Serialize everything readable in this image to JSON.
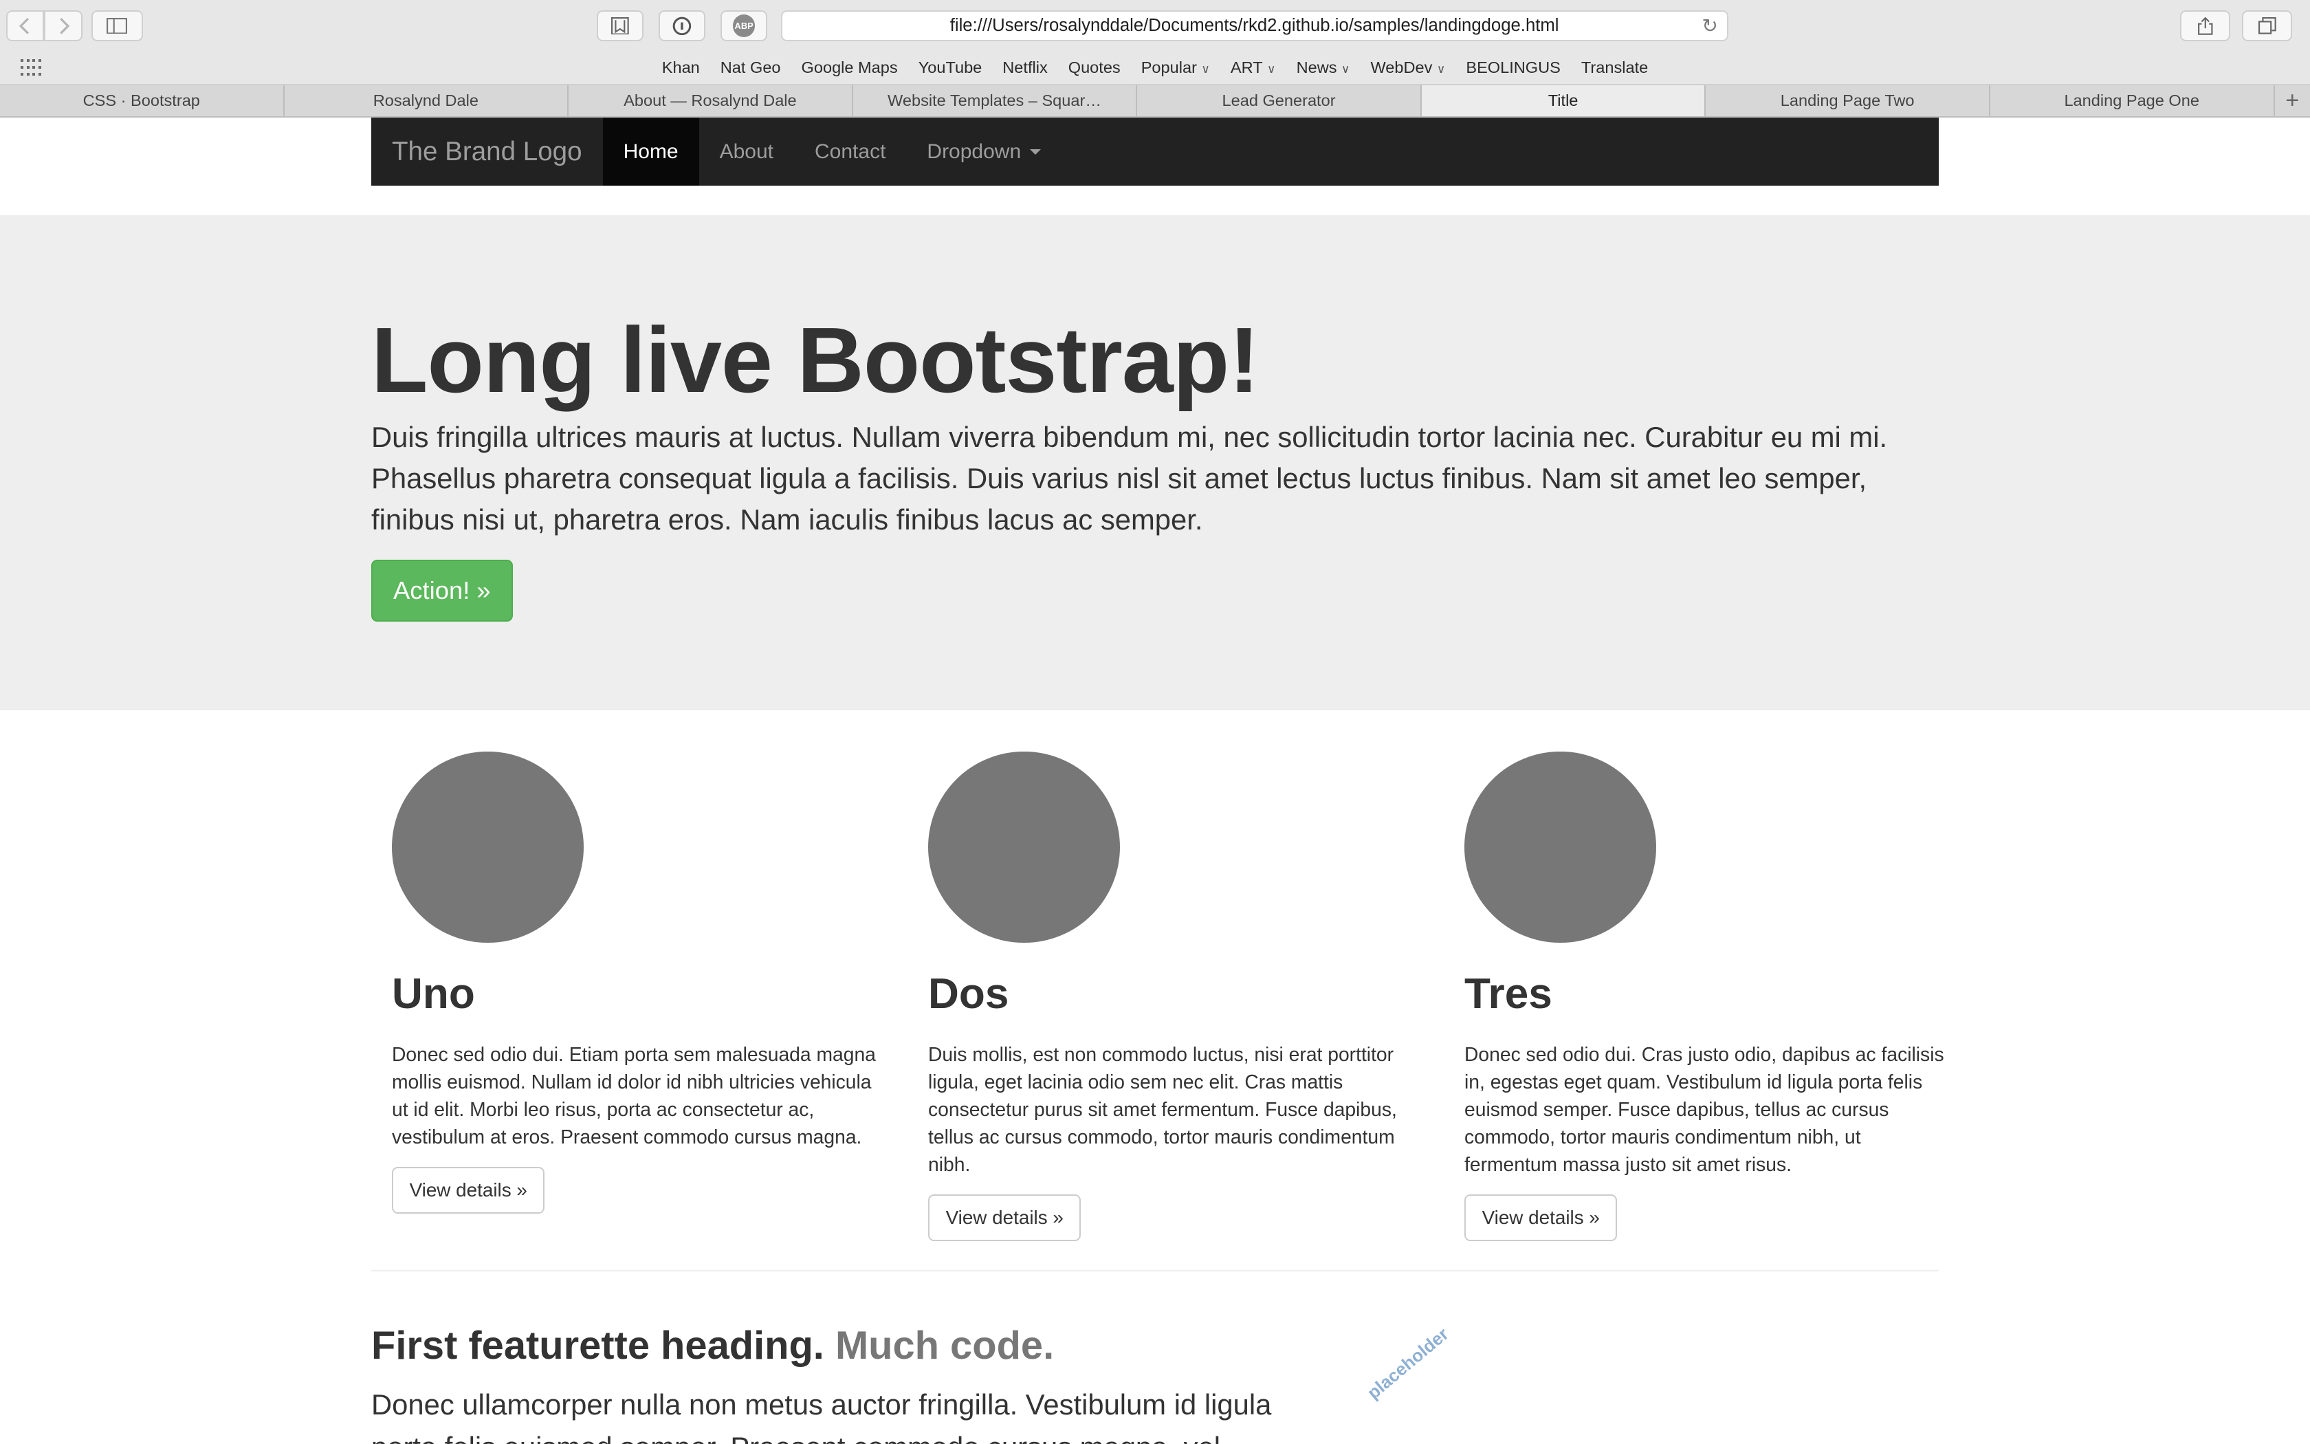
{
  "browser": {
    "url": "file:///Users/rosalynddale/Documents/rkd2.github.io/samples/landingdoge.html",
    "favorites": [
      {
        "label": "Khan",
        "dropdown": false
      },
      {
        "label": "Nat Geo",
        "dropdown": false
      },
      {
        "label": "Google Maps",
        "dropdown": false
      },
      {
        "label": "YouTube",
        "dropdown": false
      },
      {
        "label": "Netflix",
        "dropdown": false
      },
      {
        "label": "Quotes",
        "dropdown": false
      },
      {
        "label": "Popular",
        "dropdown": true
      },
      {
        "label": "ART",
        "dropdown": true
      },
      {
        "label": "News",
        "dropdown": true
      },
      {
        "label": "WebDev",
        "dropdown": true
      },
      {
        "label": "BEOLINGUS",
        "dropdown": false
      },
      {
        "label": "Translate",
        "dropdown": false
      }
    ],
    "tabs": [
      {
        "label": "CSS · Bootstrap",
        "active": false
      },
      {
        "label": "Rosalynd Dale",
        "active": false
      },
      {
        "label": "About — Rosalynd Dale",
        "active": false
      },
      {
        "label": "Website Templates – Squar…",
        "active": false
      },
      {
        "label": "Lead Generator",
        "active": false
      },
      {
        "label": "Title",
        "active": true
      },
      {
        "label": "Landing Page Two",
        "active": false
      },
      {
        "label": "Landing Page One",
        "active": false
      }
    ],
    "abp_label": "ABP"
  },
  "navbar": {
    "brand": "The Brand Logo",
    "items": [
      {
        "label": "Home",
        "active": true
      },
      {
        "label": "About",
        "active": false
      },
      {
        "label": "Contact",
        "active": false
      }
    ],
    "dropdown_label": "Dropdown"
  },
  "jumbotron": {
    "title": "Long live Bootstrap!",
    "text": "Duis fringilla ultrices mauris at luctus. Nullam viverra bibendum mi, nec sollicitudin tortor lacinia nec. Curabitur eu mi mi. Phasellus pharetra consequat ligula a facilisis. Duis varius nisl sit amet lectus luctus finibus. Nam sit amet leo semper, finibus nisi ut, pharetra eros. Nam iaculis finibus lacus ac semper.",
    "button": "Action! »"
  },
  "columns": [
    {
      "heading": "Uno",
      "text": "Donec sed odio dui. Etiam porta sem malesuada magna mollis euismod. Nullam id dolor id nibh ultricies vehicula ut id elit. Morbi leo risus, porta ac consectetur ac, vestibulum at eros. Praesent commodo cursus magna.",
      "button": "View details »"
    },
    {
      "heading": "Dos",
      "text": "Duis mollis, est non commodo luctus, nisi erat porttitor ligula, eget lacinia odio sem nec elit. Cras mattis consectetur purus sit amet fermentum. Fusce dapibus, tellus ac cursus commodo, tortor mauris condimentum nibh.",
      "button": "View details »"
    },
    {
      "heading": "Tres",
      "text": "Donec sed odio dui. Cras justo odio, dapibus ac facilisis in, egestas eget quam. Vestibulum id ligula porta felis euismod semper. Fusce dapibus, tellus ac cursus commodo, tortor mauris condimentum nibh, ut fermentum massa justo sit amet risus.",
      "button": "View details »"
    }
  ],
  "featurette": {
    "heading": "First featurette heading.",
    "heading_muted": "Much code.",
    "text": "Donec ullamcorper nulla non metus auctor fringilla. Vestibulum id ligula porta felis euismod semper. Praesent commodo cursus magna, vel",
    "image_label": "placeholder"
  },
  "colors": {
    "navbar_bg": "#222222",
    "jumbotron_bg": "#eeeeee",
    "success": "#5cb85c",
    "circle": "#777777"
  }
}
